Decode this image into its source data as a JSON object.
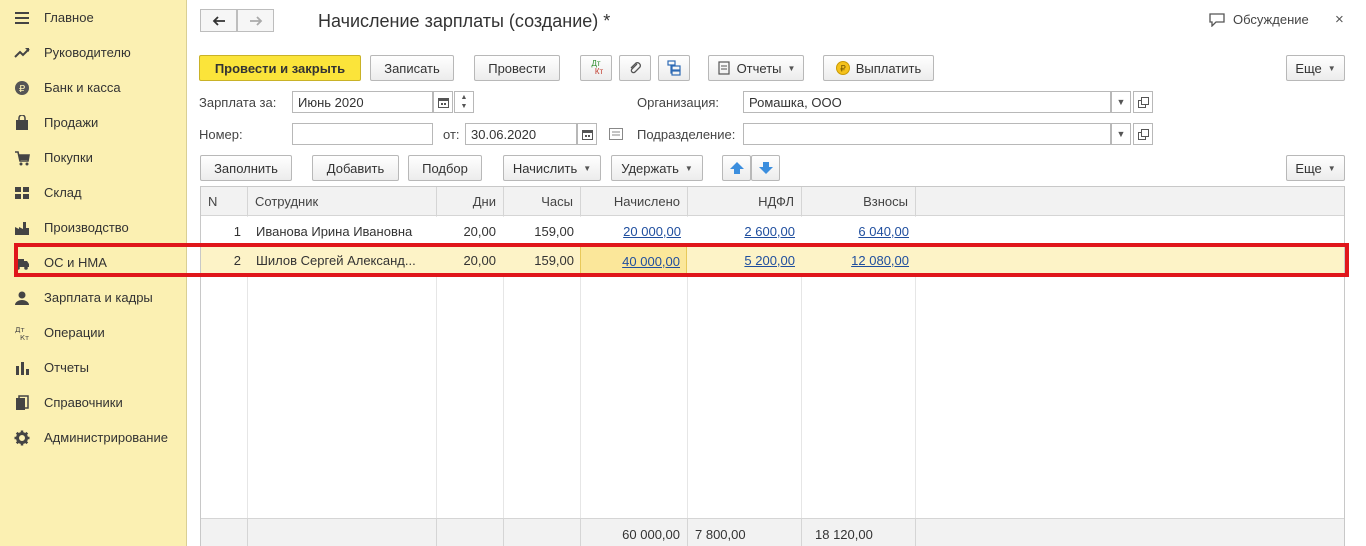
{
  "sidebar": {
    "items": [
      {
        "label": "Главное",
        "icon": "menu-icon"
      },
      {
        "label": "Руководителю",
        "icon": "trend-icon"
      },
      {
        "label": "Банк и касса",
        "icon": "ruble-coin-icon"
      },
      {
        "label": "Продажи",
        "icon": "shopping-bag-icon"
      },
      {
        "label": "Покупки",
        "icon": "cart-icon"
      },
      {
        "label": "Склад",
        "icon": "warehouse-icon"
      },
      {
        "label": "Производство",
        "icon": "factory-icon"
      },
      {
        "label": "ОС и НМА",
        "icon": "truck-icon"
      },
      {
        "label": "Зарплата и кадры",
        "icon": "person-icon"
      },
      {
        "label": "Операции",
        "icon": "dt-kt-icon"
      },
      {
        "label": "Отчеты",
        "icon": "bar-chart-icon"
      },
      {
        "label": "Справочники",
        "icon": "books-icon"
      },
      {
        "label": "Администрирование",
        "icon": "gear-icon"
      }
    ]
  },
  "header": {
    "title": "Начисление зарплаты (создание) *",
    "discuss": "Обсуждение",
    "close": "×"
  },
  "toolbar": {
    "post_close": "Провести и закрыть",
    "save": "Записать",
    "post": "Провести",
    "dtkt_top": "Дт",
    "dtkt_bottom": "Кт",
    "reports": "Отчеты",
    "pay": "Выплатить",
    "more": "Еще"
  },
  "form": {
    "salary_for_label": "Зарплата за:",
    "salary_for_value": "Июнь 2020",
    "org_label": "Организация:",
    "org_value": "Ромашка, ООО",
    "number_label": "Номер:",
    "number_value": "",
    "from_label": "от:",
    "from_value": "30.06.2020",
    "dept_label": "Подразделение:",
    "dept_value": ""
  },
  "table_toolbar": {
    "fill": "Заполнить",
    "add": "Добавить",
    "select": "Подбор",
    "accrue": "Начислить",
    "withhold": "Удержать",
    "more": "Еще"
  },
  "table": {
    "columns": [
      "N",
      "Сотрудник",
      "Дни",
      "Часы",
      "Начислено",
      "НДФЛ",
      "Взносы"
    ],
    "rows": [
      {
        "n": "1",
        "employee": "Иванова Ирина Ивановна",
        "days": "20,00",
        "hours": "159,00",
        "accrued": "20 000,00",
        "ndfl": "2 600,00",
        "contrib": "6 040,00"
      },
      {
        "n": "2",
        "employee": "Шилов Сергей Александ...",
        "days": "20,00",
        "hours": "159,00",
        "accrued": "40 000,00",
        "ndfl": "5 200,00",
        "contrib": "12 080,00"
      }
    ],
    "totals": {
      "accrued": "60 000,00",
      "ndfl": "7 800,00",
      "contrib": "18 120,00"
    }
  },
  "colors": {
    "sidebar_bg": "#fbf0b2",
    "primary_button": "#fbe43a",
    "selected_row": "#fdf3c7",
    "highlight_border": "#e0161b",
    "link": "#1f4e9e"
  }
}
